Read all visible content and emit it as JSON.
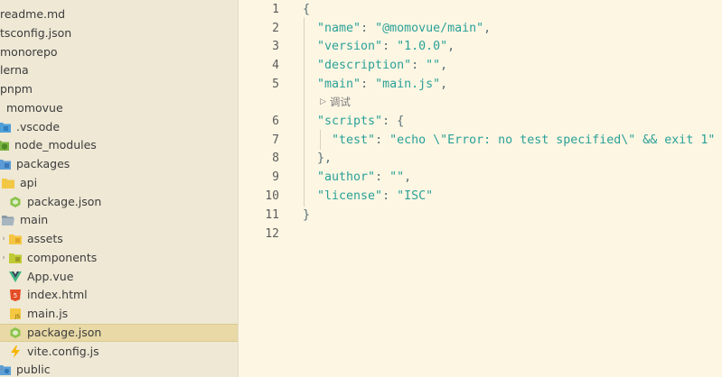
{
  "sidebar": {
    "items": [
      {
        "label": "readme.md",
        "icon": "markdown-file-icon"
      },
      {
        "label": "tsconfig.json",
        "icon": "json-file-icon"
      },
      {
        "label": "monorepo",
        "icon": "none"
      },
      {
        "label": "lerna",
        "icon": "none"
      },
      {
        "label": "pnpm",
        "icon": "none"
      },
      {
        "label": "momovue",
        "icon": "none"
      },
      {
        "label": ".vscode",
        "icon": "vscode-folder-icon"
      },
      {
        "label": "node_modules",
        "icon": "node-folder-icon"
      },
      {
        "label": "packages",
        "icon": "packages-folder-icon"
      },
      {
        "label": "api",
        "icon": "folder-icon"
      },
      {
        "label": "package.json",
        "icon": "npm-json-icon"
      },
      {
        "label": "main",
        "icon": "folder-open-icon"
      },
      {
        "label": "assets",
        "icon": "assets-folder-icon"
      },
      {
        "label": "components",
        "icon": "components-folder-icon"
      },
      {
        "label": "App.vue",
        "icon": "vue-file-icon"
      },
      {
        "label": "index.html",
        "icon": "html-file-icon"
      },
      {
        "label": "main.js",
        "icon": "js-file-icon"
      },
      {
        "label": "package.json",
        "icon": "npm-json-icon"
      },
      {
        "label": "vite.config.js",
        "icon": "vite-file-icon"
      },
      {
        "label": "public",
        "icon": "public-folder-icon"
      }
    ],
    "selected_index": 17
  },
  "editor": {
    "codelens_label": "调试",
    "lines": [
      {
        "n": "1",
        "tokens": [
          {
            "t": "{",
            "c": "punc"
          }
        ]
      },
      {
        "n": "2",
        "tokens": [
          {
            "t": "  ",
            "c": "punc"
          },
          {
            "t": "\"name\"",
            "c": "key"
          },
          {
            "t": ": ",
            "c": "punc"
          },
          {
            "t": "\"@momovue/main\"",
            "c": "str"
          },
          {
            "t": ",",
            "c": "punc"
          }
        ]
      },
      {
        "n": "3",
        "tokens": [
          {
            "t": "  ",
            "c": "punc"
          },
          {
            "t": "\"version\"",
            "c": "key"
          },
          {
            "t": ": ",
            "c": "punc"
          },
          {
            "t": "\"1.0.0\"",
            "c": "str"
          },
          {
            "t": ",",
            "c": "punc"
          }
        ]
      },
      {
        "n": "4",
        "tokens": [
          {
            "t": "  ",
            "c": "punc"
          },
          {
            "t": "\"description\"",
            "c": "key"
          },
          {
            "t": ": ",
            "c": "punc"
          },
          {
            "t": "\"\"",
            "c": "str"
          },
          {
            "t": ",",
            "c": "punc"
          }
        ]
      },
      {
        "n": "5",
        "tokens": [
          {
            "t": "  ",
            "c": "punc"
          },
          {
            "t": "\"main\"",
            "c": "key"
          },
          {
            "t": ": ",
            "c": "punc"
          },
          {
            "t": "\"main.js\"",
            "c": "str"
          },
          {
            "t": ",",
            "c": "punc"
          }
        ]
      },
      {
        "n": "6",
        "tokens": [
          {
            "t": "  ",
            "c": "punc"
          },
          {
            "t": "\"scripts\"",
            "c": "key"
          },
          {
            "t": ": {",
            "c": "punc"
          }
        ]
      },
      {
        "n": "7",
        "tokens": [
          {
            "t": "    ",
            "c": "punc"
          },
          {
            "t": "\"test\"",
            "c": "key"
          },
          {
            "t": ": ",
            "c": "punc"
          },
          {
            "t": "\"echo \\\"Error: no test specified\\\" && exit 1\"",
            "c": "str"
          }
        ]
      },
      {
        "n": "8",
        "tokens": [
          {
            "t": "  },",
            "c": "punc"
          }
        ]
      },
      {
        "n": "9",
        "tokens": [
          {
            "t": "  ",
            "c": "punc"
          },
          {
            "t": "\"author\"",
            "c": "key"
          },
          {
            "t": ": ",
            "c": "punc"
          },
          {
            "t": "\"\"",
            "c": "str"
          },
          {
            "t": ",",
            "c": "punc"
          }
        ]
      },
      {
        "n": "10",
        "tokens": [
          {
            "t": "  ",
            "c": "punc"
          },
          {
            "t": "\"license\"",
            "c": "key"
          },
          {
            "t": ": ",
            "c": "punc"
          },
          {
            "t": "\"ISC\"",
            "c": "str"
          }
        ]
      },
      {
        "n": "11",
        "tokens": [
          {
            "t": "}",
            "c": "punc"
          }
        ]
      },
      {
        "n": "12",
        "tokens": []
      }
    ]
  },
  "colors": {
    "editor_bg": "#fdf6e3",
    "sidebar_bg": "#eee8d5",
    "selection_bg": "#e8d9a6",
    "token_string": "#2aa198",
    "token_punctuation": "#586e75"
  }
}
